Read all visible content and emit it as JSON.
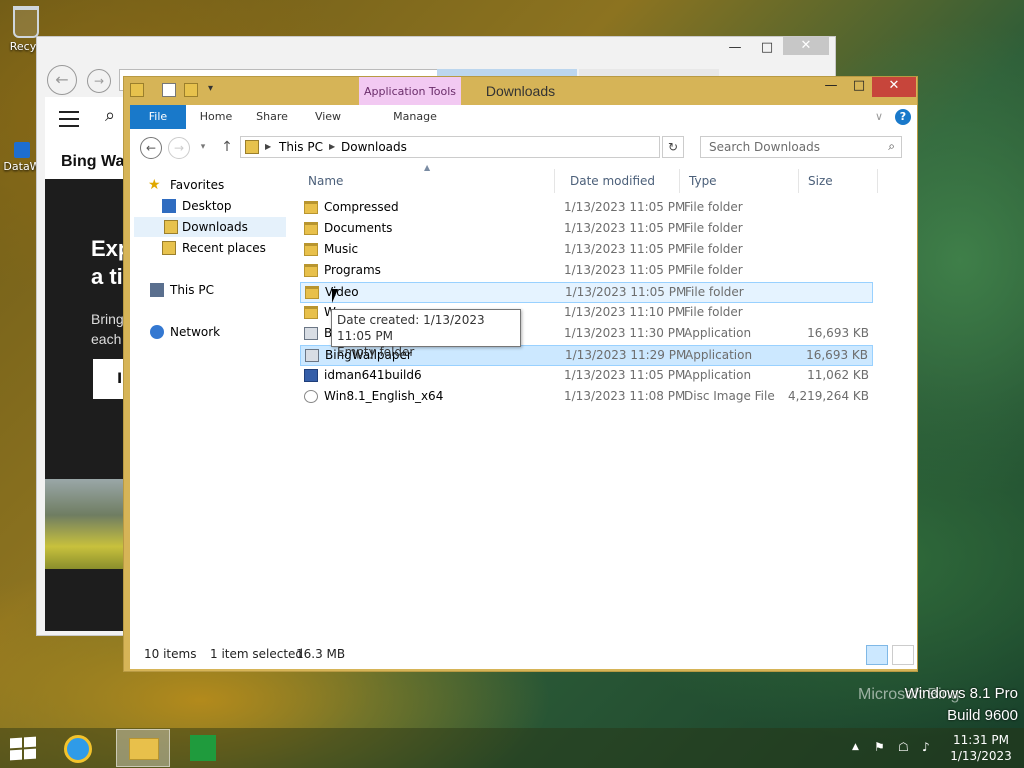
{
  "desktop": {
    "icons": [
      {
        "label": "Recyc"
      },
      {
        "label": "DataW"
      }
    ],
    "watermark": {
      "bing": "Microsoft Bing",
      "os": "Windows 8.1 Pro",
      "build": "Build 9600"
    }
  },
  "browser": {
    "min": "—",
    "max": "□",
    "close": "✕",
    "back": "←",
    "fwd": "→",
    "page_title": "Bing Wal",
    "hero_heading_1": "Exp",
    "hero_heading_2": "a ti",
    "hero_text_1": "Bring",
    "hero_text_2": "each",
    "hero_button": "I"
  },
  "explorer": {
    "title": "Downloads",
    "context_tab": "Application Tools",
    "window_buttons": {
      "min": "—",
      "max": "□",
      "close": "✕"
    },
    "qat_dropdown": "▾",
    "ribbon_tabs": {
      "file": "File",
      "home": "Home",
      "share": "Share",
      "view": "View",
      "manage": "Manage",
      "collapse": "∨",
      "help": "?"
    },
    "nav": {
      "back": "←",
      "fwd": "→",
      "recent": "▾",
      "up": "↑",
      "sep": "▶",
      "breadcrumb": [
        "This PC",
        "Downloads"
      ],
      "addr_dropdown": "∨",
      "refresh": "↻",
      "search_placeholder": "Search Downloads",
      "search_icon": "⌕"
    },
    "navpane": {
      "favorites": "Favorites",
      "desktop": "Desktop",
      "downloads": "Downloads",
      "recent": "Recent places",
      "this_pc": "This PC",
      "network": "Network",
      "star": "★"
    },
    "columns": {
      "name": "Name",
      "date": "Date modified",
      "type": "Type",
      "size": "Size",
      "sort_indicator": "▲"
    },
    "files": [
      {
        "name": "Compressed",
        "date": "1/13/2023 11:05 PM",
        "type": "File folder",
        "size": "",
        "icon": "folder-icon"
      },
      {
        "name": "Documents",
        "date": "1/13/2023 11:05 PM",
        "type": "File folder",
        "size": "",
        "icon": "folder-icon"
      },
      {
        "name": "Music",
        "date": "1/13/2023 11:05 PM",
        "type": "File folder",
        "size": "",
        "icon": "folder-icon"
      },
      {
        "name": "Programs",
        "date": "1/13/2023 11:05 PM",
        "type": "File folder",
        "size": "",
        "icon": "folder-icon"
      },
      {
        "name": "Video",
        "date": "1/13/2023 11:05 PM",
        "type": "File folder",
        "size": "",
        "icon": "folder-icon"
      },
      {
        "name": "W",
        "date": "1/13/2023 11:10 PM",
        "type": "File folder",
        "size": "",
        "icon": "folder-icon"
      },
      {
        "name": "B",
        "date": "1/13/2023 11:30 PM",
        "type": "Application",
        "size": "16,693 KB",
        "icon": "app-icon"
      },
      {
        "name": "BingWallpaper",
        "date": "1/13/2023 11:29 PM",
        "type": "Application",
        "size": "16,693 KB",
        "icon": "app-icon"
      },
      {
        "name": "idman641build6",
        "date": "1/13/2023 11:05 PM",
        "type": "Application",
        "size": "11,062 KB",
        "icon": "app-icon"
      },
      {
        "name": "Win8.1_English_x64",
        "date": "1/13/2023 11:08 PM",
        "type": "Disc Image File",
        "size": "4,219,264 KB",
        "icon": "disc-image-icon"
      }
    ],
    "tooltip": {
      "line1": "Date created: 1/13/2023 11:05 PM",
      "line2": "Empty folder"
    },
    "status": {
      "items": "10 items",
      "selected": "1 item selected",
      "size": "16.3 MB"
    }
  },
  "taskbar": {
    "clock_time": "11:31 PM",
    "clock_date": "1/13/2023",
    "tray_up": "▲",
    "tray_flag": "⚑",
    "tray_net": "☖",
    "tray_vol": "♪"
  }
}
